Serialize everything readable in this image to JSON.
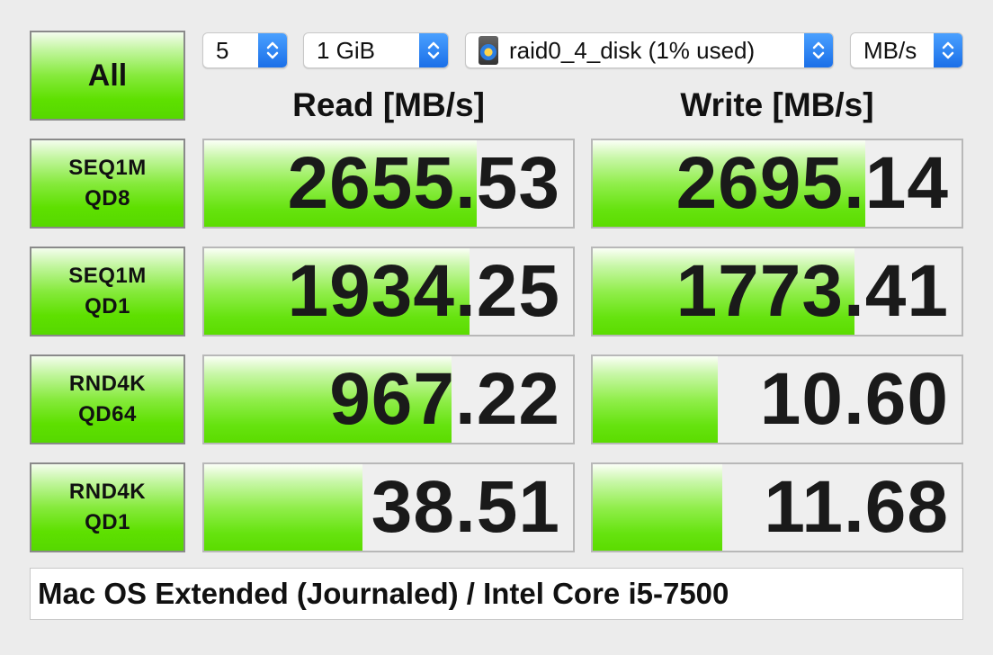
{
  "buttons": {
    "all_label": "All",
    "tests": [
      {
        "line1": "SEQ1M",
        "line2": "QD8"
      },
      {
        "line1": "SEQ1M",
        "line2": "QD1"
      },
      {
        "line1": "RND4K",
        "line2": "QD64"
      },
      {
        "line1": "RND4K",
        "line2": "QD1"
      }
    ]
  },
  "controls": {
    "count": "5",
    "size": "1 GiB",
    "drive": "raid0_4_disk (1% used)",
    "unit": "MB/s"
  },
  "headers": {
    "read": "Read [MB/s]",
    "write": "Write [MB/s]"
  },
  "results": [
    {
      "read": "2655.53",
      "read_fill": 0.74,
      "write": "2695.14",
      "write_fill": 0.74
    },
    {
      "read": "1934.25",
      "read_fill": 0.72,
      "write": "1773.41",
      "write_fill": 0.71
    },
    {
      "read": "967.22",
      "read_fill": 0.67,
      "write": "10.60",
      "write_fill": 0.34
    },
    {
      "read": "38.51",
      "read_fill": 0.43,
      "write": "11.68",
      "write_fill": 0.35
    }
  ],
  "status": "Mac OS Extended (Journaled) / Intel Core i5-7500",
  "colors": {
    "fill_green": "#5bdc00",
    "stepper_blue": "#1a6fe8",
    "background": "#ececec"
  }
}
